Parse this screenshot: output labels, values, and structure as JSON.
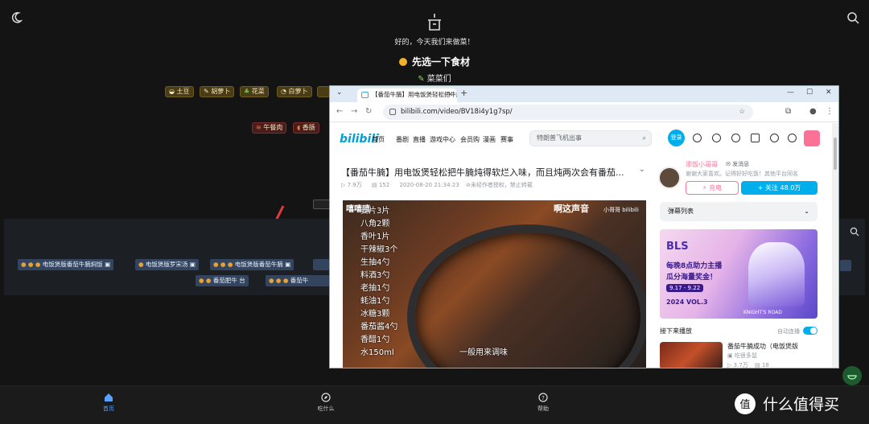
{
  "header": {
    "subtitle": "好的，今天我们来做菜！",
    "heading": "先选一下食材",
    "sub_heading": "菜菜们"
  },
  "vegetables": [
    {
      "icon": "potato-icon",
      "label": "土豆"
    },
    {
      "icon": "carrot-icon",
      "label": "胡萝卜"
    },
    {
      "icon": "broccoli-icon",
      "label": "花菜"
    },
    {
      "icon": "radish-icon",
      "label": "白萝卜"
    }
  ],
  "meats": [
    {
      "icon": "bacon-icon",
      "label": "午餐肉"
    },
    {
      "icon": "sausage-icon",
      "label": "香肠"
    }
  ],
  "recipes": [
    {
      "label": "电饭煲版番茄牛腩焖饭"
    },
    {
      "label": "电饭煲版罗宋汤"
    },
    {
      "label": "电饭煲版番茄牛腩"
    },
    {
      "label": "番茄肥牛"
    },
    {
      "label": "番茄牛"
    }
  ],
  "browser": {
    "tab_title": "【番茄牛腩】用电饭煲轻松把牛腩",
    "url": "bilibili.com/video/BV18i4y1g7sp/"
  },
  "bili": {
    "logo": "bilibili",
    "nav": [
      "首页",
      "番剧",
      "直播",
      "游戏中心",
      "会员购",
      "漫画",
      "赛事"
    ],
    "search_placeholder": "特朗普飞机出事",
    "login": "登录",
    "video_title": "【番茄牛腩】用电饭煲轻松把牛腩炖得软烂入味，而且炖两次会有番茄...",
    "views": "7.9万",
    "danmaku_count": "152",
    "date": "2020-08-20 21:34:23",
    "copyright": "未经作者授权，禁止转载",
    "video_overlay": {
      "top_left": "嘻嘻嘻",
      "top_right": "啊这声音",
      "top_right_small": "小哥哥 bilibili",
      "ingredients": [
        "姜片3片",
        "八角2颗",
        "香叶1片",
        "干辣椒3个",
        "生抽4勺",
        "料酒3勺",
        "老抽1勺",
        "蚝油1勺",
        "冰糖3颗",
        "番茄酱4勺",
        "香醋1勺",
        "水150ml"
      ],
      "subtitle": "一般用来调味"
    },
    "up_name": "添饭小哥哥",
    "send_msg": "发消息",
    "up_desc": "谢谢大家喜欢。记得好好吃饭！其他平台同名",
    "charge": "充电",
    "follow": "+ 关注 48.0万",
    "danmu_list": "弹幕列表",
    "banner": {
      "title": "BLS",
      "line1": "每晚8点助力主播",
      "line2": "瓜分海量奖金！",
      "dates": "9.17 - 9.22",
      "year": "2024 VOL.3",
      "footer": "KNIGHT'S ROAD"
    },
    "next_play": "接下来播放",
    "autoplay": "自动连播",
    "rec_title": "番茄牛腩成功（电饭煲版",
    "rec_up": "吃很多鼠",
    "rec_views": "3.7万",
    "rec_danmu": "18"
  },
  "bottom_nav": [
    {
      "label": "首页",
      "icon": "home-icon"
    },
    {
      "label": "吃什么",
      "icon": "compass-icon"
    },
    {
      "label": "帮助",
      "icon": "help-icon"
    }
  ],
  "watermark": "值 什么值得买",
  "colors": {
    "accent": "#00aeec",
    "pink": "#fb7299",
    "chip": "#4a3c14",
    "tag": "#33455e",
    "active_nav": "#5aa0ff"
  }
}
